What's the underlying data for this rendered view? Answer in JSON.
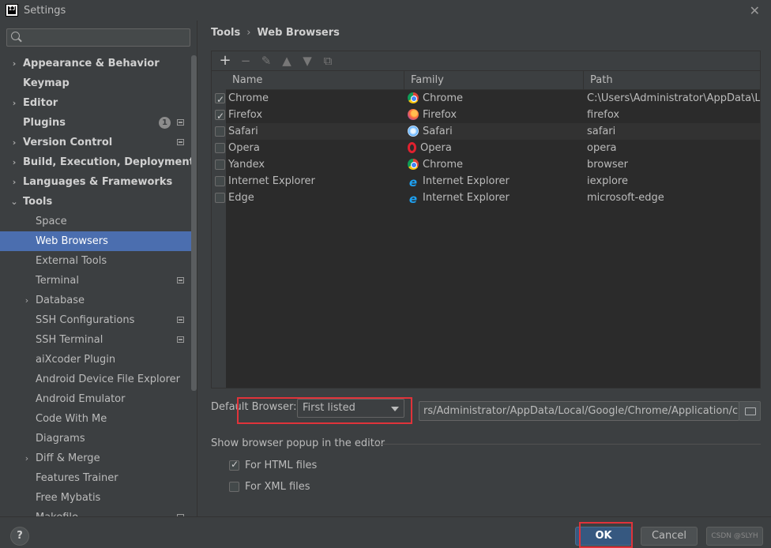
{
  "window": {
    "title": "Settings",
    "app_icon": "IJ"
  },
  "search": {
    "placeholder": ""
  },
  "sidebar": {
    "items": [
      {
        "label": "Appearance & Behavior",
        "bold": true,
        "arrow": "›",
        "indent": 0
      },
      {
        "label": "Keymap",
        "bold": true,
        "arrow": "",
        "indent": 0
      },
      {
        "label": "Editor",
        "bold": true,
        "arrow": "›",
        "indent": 0
      },
      {
        "label": "Plugins",
        "bold": true,
        "arrow": "",
        "indent": 0,
        "badge": "1",
        "proj": true
      },
      {
        "label": "Version Control",
        "bold": true,
        "arrow": "›",
        "indent": 0,
        "proj": true
      },
      {
        "label": "Build, Execution, Deployment",
        "bold": true,
        "arrow": "›",
        "indent": 0
      },
      {
        "label": "Languages & Frameworks",
        "bold": true,
        "arrow": "›",
        "indent": 0
      },
      {
        "label": "Tools",
        "bold": true,
        "arrow": "⌄",
        "indent": 0
      },
      {
        "label": "Space",
        "bold": false,
        "arrow": "",
        "indent": 1
      },
      {
        "label": "Web Browsers",
        "bold": false,
        "arrow": "",
        "indent": 1,
        "selected": true
      },
      {
        "label": "External Tools",
        "bold": false,
        "arrow": "",
        "indent": 1
      },
      {
        "label": "Terminal",
        "bold": false,
        "arrow": "",
        "indent": 1,
        "proj": true
      },
      {
        "label": "Database",
        "bold": false,
        "arrow": "›",
        "indent": 1
      },
      {
        "label": "SSH Configurations",
        "bold": false,
        "arrow": "",
        "indent": 1,
        "proj": true
      },
      {
        "label": "SSH Terminal",
        "bold": false,
        "arrow": "",
        "indent": 1,
        "proj": true
      },
      {
        "label": "aiXcoder Plugin",
        "bold": false,
        "arrow": "",
        "indent": 1
      },
      {
        "label": "Android Device File Explorer",
        "bold": false,
        "arrow": "",
        "indent": 1
      },
      {
        "label": "Android Emulator",
        "bold": false,
        "arrow": "",
        "indent": 1
      },
      {
        "label": "Code With Me",
        "bold": false,
        "arrow": "",
        "indent": 1
      },
      {
        "label": "Diagrams",
        "bold": false,
        "arrow": "",
        "indent": 1
      },
      {
        "label": "Diff & Merge",
        "bold": false,
        "arrow": "›",
        "indent": 1
      },
      {
        "label": "Features Trainer",
        "bold": false,
        "arrow": "",
        "indent": 1
      },
      {
        "label": "Free Mybatis",
        "bold": false,
        "arrow": "",
        "indent": 1
      },
      {
        "label": "Makefile... ",
        "bold": false,
        "arrow": "",
        "indent": 1,
        "proj": true
      }
    ]
  },
  "breadcrumb": {
    "parent": "Tools",
    "separator": "›",
    "current": "Web Browsers"
  },
  "toolbar": {
    "add": "+",
    "remove": "−",
    "edit": "✎",
    "up": "▲",
    "down": "▼",
    "copy": "⧉"
  },
  "table": {
    "columns": [
      "Name",
      "Family",
      "Path"
    ],
    "rows": [
      {
        "checked": true,
        "name": "Chrome",
        "family": "Chrome",
        "family_icon": "chrome-icon",
        "path": "C:\\Users\\Administrator\\AppData\\Lo..."
      },
      {
        "checked": true,
        "name": "Firefox",
        "family": "Firefox",
        "family_icon": "firefox-icon",
        "path": "firefox"
      },
      {
        "checked": false,
        "name": "Safari",
        "family": "Safari",
        "family_icon": "safari-icon",
        "path": "safari",
        "highlighted": true
      },
      {
        "checked": false,
        "name": "Opera",
        "family": "Opera",
        "family_icon": "opera-icon",
        "path": "opera"
      },
      {
        "checked": false,
        "name": "Yandex",
        "family": "Chrome",
        "family_icon": "chrome-icon",
        "path": "browser"
      },
      {
        "checked": false,
        "name": "Internet Explorer",
        "family": "Internet Explorer",
        "family_icon": "ie-icon",
        "path": "iexplore"
      },
      {
        "checked": false,
        "name": "Edge",
        "family": "Internet Explorer",
        "family_icon": "ie-icon",
        "path": "microsoft-edge"
      }
    ]
  },
  "default_browser": {
    "label": "Default Browser:",
    "selected": "First listed",
    "path": "rs/Administrator/AppData/Local/Google/Chrome/Application/chrome"
  },
  "popup": {
    "title": "Show browser popup in the editor",
    "html_label": "For HTML files",
    "html_checked": true,
    "xml_label": "For XML files",
    "xml_checked": false
  },
  "buttons": {
    "help": "?",
    "ok": "OK",
    "cancel": "Cancel",
    "apply": "CSDN @SLYH"
  },
  "colors": {
    "accent": "#4b6eaf",
    "ok_button": "#365880",
    "highlight_box": "#e0333a"
  }
}
